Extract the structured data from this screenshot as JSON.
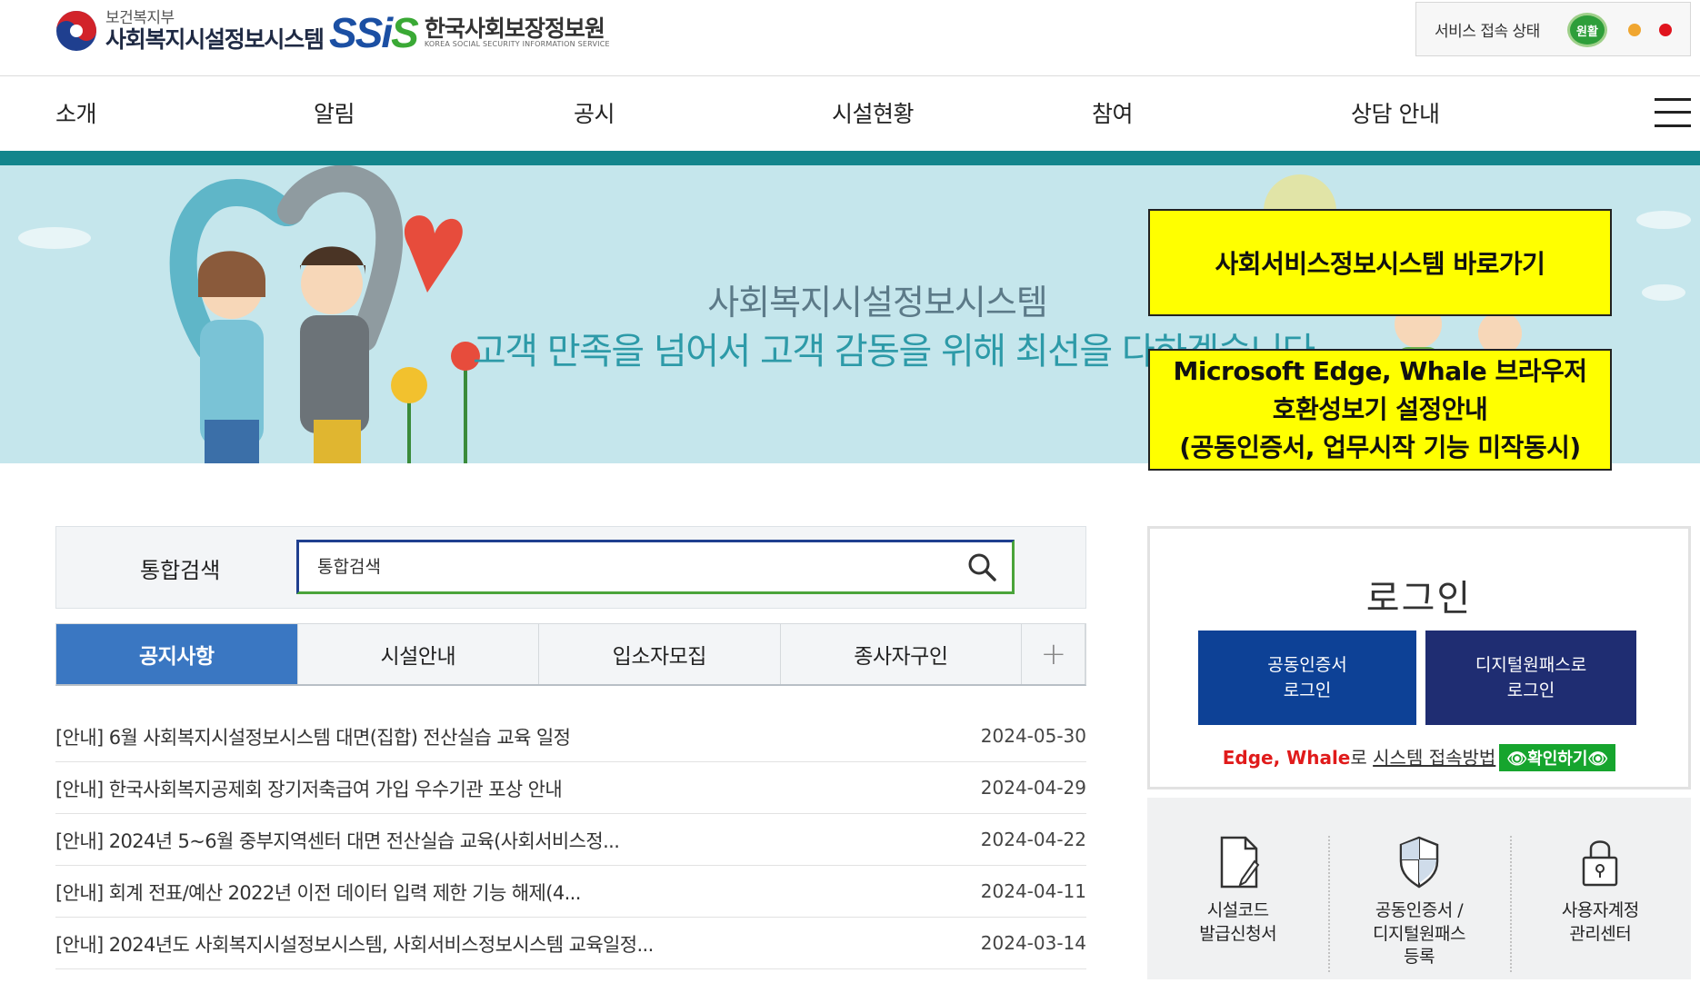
{
  "header": {
    "ministry_sub": "보건복지부",
    "ministry_main": "사회복지시설정보시스템",
    "ssis_mark": "SSiS",
    "ssis_name": "한국사회보장정보원",
    "ssis_eng": "KOREA SOCIAL SECURITY INFORMATION SERVICE",
    "service_status_label": "서비스 접속 상태",
    "service_status_badge": "원활",
    "status_colors": {
      "good": "#2e9e3a",
      "warn": "#f0a630",
      "bad": "#e0141e"
    }
  },
  "nav": {
    "items": [
      {
        "label": "소개"
      },
      {
        "label": "알림"
      },
      {
        "label": "공시"
      },
      {
        "label": "시설현황"
      },
      {
        "label": "참여"
      },
      {
        "label": "상담 안내"
      }
    ],
    "menu_icon": "hamburger-icon"
  },
  "banner": {
    "title": "사회복지시설정보시스템",
    "slogan": "고객 만족을 넘어서 고객 감동을 위해 최선을 다하겠습니다",
    "shortcut_ssis": "사회서비스정보시스템 바로가기",
    "compat_line1": "Microsoft Edge, Whale 브라우저",
    "compat_line2": "호환성보기 설정안내",
    "compat_line3": "(공동인증서, 업무시작 기능 미작동시)"
  },
  "search": {
    "label": "통합검색",
    "placeholder": "통합검색",
    "value": "",
    "icon": "search-icon"
  },
  "tabs": [
    {
      "label": "공지사항",
      "active": true
    },
    {
      "label": "시설안내",
      "active": false
    },
    {
      "label": "입소자모집",
      "active": false
    },
    {
      "label": "종사자구인",
      "active": false
    }
  ],
  "tabs_more": "+",
  "notices": [
    {
      "title": "[안내] 6월 사회복지시설정보시스템 대면(집합) 전산실습 교육 일정",
      "date": "2024-05-30"
    },
    {
      "title": "[안내] 한국사회복지공제회 장기저축급여 가입 우수기관 포상 안내",
      "date": "2024-04-29"
    },
    {
      "title": "[안내] 2024년 5~6월 중부지역센터 대면 전산실습 교육(사회서비스정...",
      "date": "2024-04-22"
    },
    {
      "title": "[안내] 회계 전표/예산 2022년 이전 데이터 입력 제한 기능 해제(4...",
      "date": "2024-04-11"
    },
    {
      "title": "[안내] 2024년도 사회복지시설정보시스템, 사회서비스정보시스템 교육일정...",
      "date": "2024-03-14"
    }
  ],
  "login": {
    "title": "로그인",
    "cert_line1": "공동인증서",
    "cert_line2": "로그인",
    "digital_line1": "디지털원패스로",
    "digital_line2": "로그인",
    "help_browsers": "Edge, Whale",
    "help_ro": "로 ",
    "help_link": "시스템 접속방법",
    "help_button": "👁확인하기👁"
  },
  "quick_links": [
    {
      "label": "시설코드\n발급신청서",
      "icon": "document-icon"
    },
    {
      "label": "공동인증서 /\n디지털원패스\n등록",
      "icon": "shield-icon"
    },
    {
      "label": "사용자계정\n관리센터",
      "icon": "lock-icon"
    }
  ]
}
